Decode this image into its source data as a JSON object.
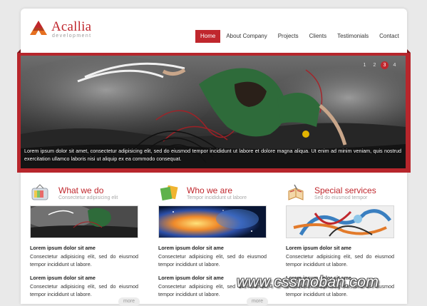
{
  "logo": {
    "name": "Acallia",
    "sub": "development"
  },
  "nav": [
    {
      "label": "Home",
      "active": true
    },
    {
      "label": "About Company"
    },
    {
      "label": "Projects"
    },
    {
      "label": "Clients"
    },
    {
      "label": "Testimonials"
    },
    {
      "label": "Contact"
    }
  ],
  "slider": {
    "caption": "Lorem ipsum dolor sit amet, consectetur adipisicing elit, sed do eiusmod tempor incididunt ut labore et dolore magna aliqua. Ut enim ad minim veniam, quis nostrud exercitation ullamco laboris nisi ut aliquip ex ea commodo consequat.",
    "pages": [
      "1",
      "2",
      "3",
      "4"
    ],
    "active_page": "3"
  },
  "columns": [
    {
      "title": "What we do",
      "subtitle": "Consectetur adipisicing elit",
      "icon": "tv-icon",
      "entries": [
        {
          "title": "Lorem ipsum dolor sit ame",
          "text": "Consectetur adipisicing elit, sed do eiusmod tempor incididunt ut labore."
        },
        {
          "title": "Lorem ipsum dolor sit ame",
          "text": "Consectetur adipisicing elit, sed do eiusmod tempor incididunt ut labore."
        }
      ],
      "more": "more"
    },
    {
      "title": "Who we are",
      "subtitle": "Tempor incididunt ut labore",
      "icon": "folders-icon",
      "entries": [
        {
          "title": "Lorem ipsum dolor sit ame",
          "text": "Consectetur adipisicing elit, sed do eiusmod tempor incididunt ut labore."
        },
        {
          "title": "Lorem ipsum dolor sit ame",
          "text": "Consectetur adipisicing elit, sed do eiusmod tempor incididunt ut labore."
        }
      ],
      "more": "more"
    },
    {
      "title": "Special services",
      "subtitle": "Sed do eiusmod tempor",
      "icon": "book-icon",
      "entries": [
        {
          "title": "Lorem ipsum dolor sit ame",
          "text": "Consectetur adipisicing elit, sed do eiusmod tempor incididunt ut labore."
        },
        {
          "title": "Lorem ipsum dolor sit ame",
          "text": "Consectetur adipisicing elit, sed do eiusmod tempor incididunt ut labore."
        }
      ],
      "more": "more"
    }
  ],
  "watermark": "www.cssmoban.com",
  "colors": {
    "accent": "#c0272d",
    "background": "#e9e9e9"
  }
}
